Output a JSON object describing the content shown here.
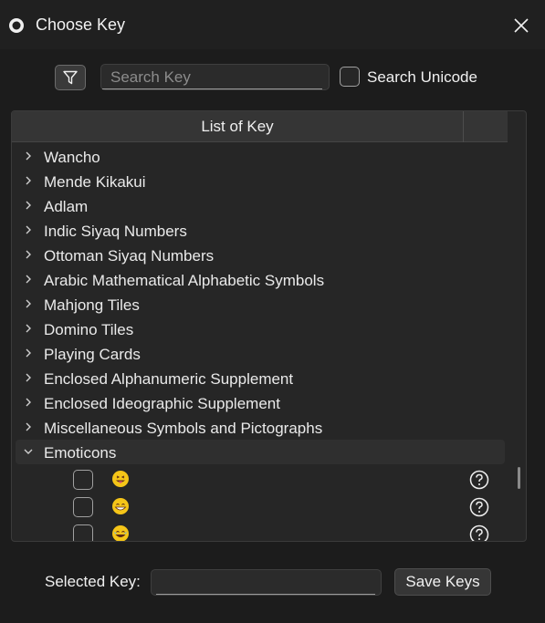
{
  "window": {
    "title": "Choose Key",
    "app_icon": "app-ring-icon",
    "close_icon": "close-icon"
  },
  "toolbar": {
    "filter_icon": "filter-icon",
    "search_placeholder": "Search Key",
    "search_value": "",
    "search_unicode_label": "Search Unicode",
    "search_unicode_checked": false
  },
  "tree": {
    "header": "List of Key",
    "items": [
      {
        "label": "Wancho",
        "expanded": false
      },
      {
        "label": "Mende Kikakui",
        "expanded": false
      },
      {
        "label": "Adlam",
        "expanded": false
      },
      {
        "label": "Indic Siyaq Numbers",
        "expanded": false
      },
      {
        "label": "Ottoman Siyaq Numbers",
        "expanded": false
      },
      {
        "label": "Arabic Mathematical Alphabetic Symbols",
        "expanded": false
      },
      {
        "label": "Mahjong Tiles",
        "expanded": false
      },
      {
        "label": "Domino Tiles",
        "expanded": false
      },
      {
        "label": "Playing Cards",
        "expanded": false
      },
      {
        "label": "Enclosed Alphanumeric Supplement",
        "expanded": false
      },
      {
        "label": "Enclosed Ideographic Supplement",
        "expanded": false
      },
      {
        "label": "Miscellaneous Symbols and Pictographs",
        "expanded": false
      },
      {
        "label": "Emoticons",
        "expanded": true
      }
    ],
    "emoticon_children": [
      {
        "emoji": "grinning-face-icon",
        "checked": false,
        "help_icon": "help-icon"
      },
      {
        "emoji": "grinning-face-with-smiling-eyes-icon",
        "checked": false,
        "help_icon": "help-icon"
      },
      {
        "emoji": "face-with-tears-of-joy-icon",
        "checked": false,
        "help_icon": "help-icon"
      }
    ]
  },
  "footer": {
    "selected_key_label": "Selected Key:",
    "selected_key_value": "",
    "save_button_label": "Save Keys"
  },
  "colors": {
    "background": "#202020",
    "panel": "#262626",
    "header": "#353535",
    "text": "#eaeaea",
    "emoji_face": "#f5c518",
    "emoji_tongue": "#e04b6d"
  }
}
